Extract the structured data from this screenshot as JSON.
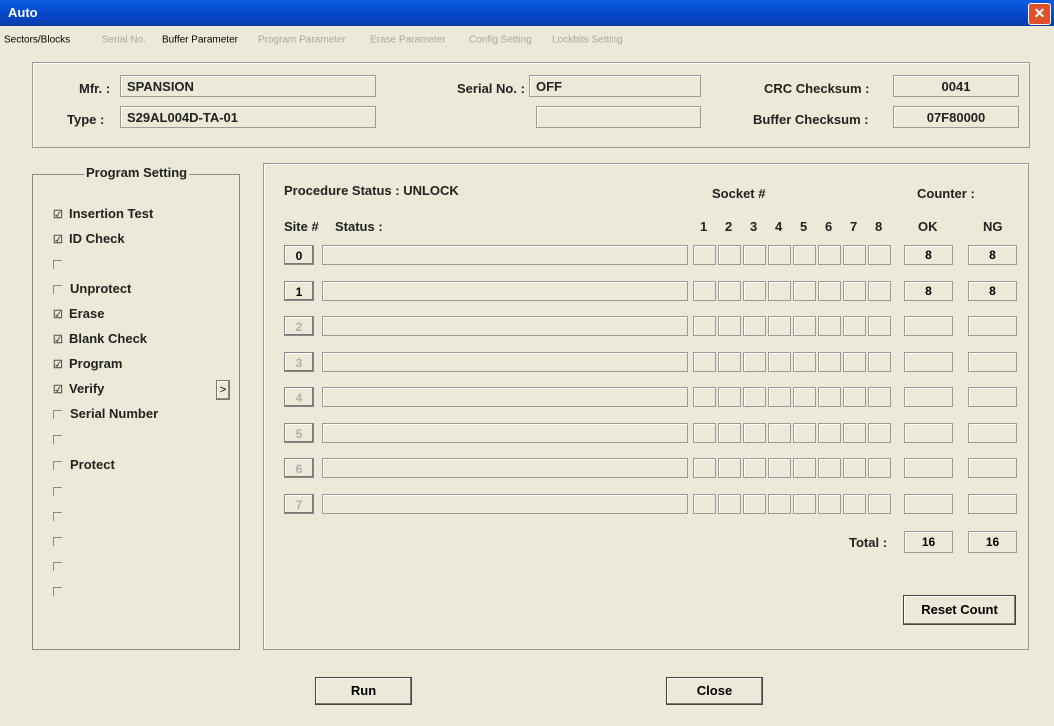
{
  "window": {
    "title": "Auto",
    "close_glyph": "✕"
  },
  "tabs": [
    {
      "label": "Sectors/Blocks",
      "state": "enabled"
    },
    {
      "label": "Serial No.",
      "state": "disabled"
    },
    {
      "label": "Buffer Parameter",
      "state": "enabled"
    },
    {
      "label": "Program Parameter",
      "state": "disabled"
    },
    {
      "label": "Erase Parameter",
      "state": "disabled"
    },
    {
      "label": "Config Setting",
      "state": "disabled"
    },
    {
      "label": "Lockbits Setting",
      "state": "disabled"
    }
  ],
  "device": {
    "mfr_label": "Mfr. :",
    "mfr_value": "SPANSION",
    "type_label": "Type :",
    "type_value": "S29AL004D-TA-01",
    "serial_label": "Serial No. :",
    "serial_value": "OFF",
    "serial_value2": "",
    "crc_label": "CRC Checksum :",
    "crc_value": "0041",
    "buffer_label": "Buffer Checksum :",
    "buffer_value": "07F80000"
  },
  "program_setting": {
    "title": "Program Setting",
    "expand_glyph": ">",
    "items": [
      {
        "label": "Insertion Test",
        "checked": true
      },
      {
        "label": "ID Check",
        "checked": true
      },
      {
        "label": "",
        "checked": false
      },
      {
        "label": "Unprotect",
        "checked": false
      },
      {
        "label": "Erase",
        "checked": true
      },
      {
        "label": "Blank Check",
        "checked": true
      },
      {
        "label": "Program",
        "checked": true
      },
      {
        "label": "Verify",
        "checked": true
      },
      {
        "label": "Serial Number",
        "checked": false
      },
      {
        "label": "",
        "checked": false
      },
      {
        "label": "Protect",
        "checked": false
      },
      {
        "label": "",
        "checked": false
      },
      {
        "label": "",
        "checked": false
      },
      {
        "label": "",
        "checked": false
      },
      {
        "label": "",
        "checked": false
      },
      {
        "label": "",
        "checked": false
      }
    ]
  },
  "status_panel": {
    "procedure_status": "Procedure Status :  UNLOCK",
    "site_header": "Site #",
    "status_header": "Status :",
    "socket_header": "Socket #",
    "counter_header": "Counter :",
    "socket_numbers": [
      "1",
      "2",
      "3",
      "4",
      "5",
      "6",
      "7",
      "8"
    ],
    "ok_header": "OK",
    "ng_header": "NG",
    "sites": [
      {
        "id": "0",
        "enabled": true,
        "ok": "8",
        "ng": "8"
      },
      {
        "id": "1",
        "enabled": true,
        "ok": "8",
        "ng": "8"
      },
      {
        "id": "2",
        "enabled": false,
        "ok": "",
        "ng": ""
      },
      {
        "id": "3",
        "enabled": false,
        "ok": "",
        "ng": ""
      },
      {
        "id": "4",
        "enabled": false,
        "ok": "",
        "ng": ""
      },
      {
        "id": "5",
        "enabled": false,
        "ok": "",
        "ng": ""
      },
      {
        "id": "6",
        "enabled": false,
        "ok": "",
        "ng": ""
      },
      {
        "id": "7",
        "enabled": false,
        "ok": "",
        "ng": ""
      }
    ],
    "total_label": "Total :",
    "total_ok": "16",
    "total_ng": "16",
    "reset_label": "Reset Count"
  },
  "buttons": {
    "run_label": "Run",
    "close_label": "Close"
  }
}
